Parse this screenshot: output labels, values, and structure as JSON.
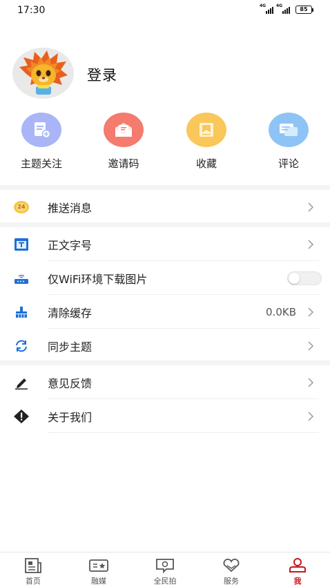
{
  "status_bar": {
    "time": "17:30",
    "network_1": "4G",
    "network_2": "4G",
    "battery": "85"
  },
  "profile": {
    "login_label": "登录",
    "avatar_icon": "lion-mascot-avatar"
  },
  "quick_actions": [
    {
      "label": "主题关注",
      "icon": "topic-follow-icon",
      "color": "#a9b5f7"
    },
    {
      "label": "邀请码",
      "icon": "invite-code-icon",
      "color": "#f47b6e"
    },
    {
      "label": "收藏",
      "icon": "favorites-icon",
      "color": "#f9c75a"
    },
    {
      "label": "评论",
      "icon": "comment-icon",
      "color": "#8ec4f5"
    }
  ],
  "menu": {
    "push": {
      "label": "推送消息",
      "badge": "24"
    },
    "font_size": {
      "label": "正文字号"
    },
    "wifi_only": {
      "label": "仅WiFi环境下载图片",
      "enabled": false
    },
    "clear_cache": {
      "label": "清除缓存",
      "value": "0.0KB"
    },
    "sync_theme": {
      "label": "同步主题"
    },
    "feedback": {
      "label": "意见反馈"
    },
    "about": {
      "label": "关于我们"
    }
  },
  "tabbar": {
    "active": "我",
    "accent": "#c8161d",
    "items": [
      {
        "label": "首页",
        "icon": "news-home-icon"
      },
      {
        "label": "融媒",
        "icon": "media-star-icon"
      },
      {
        "label": "全民拍",
        "icon": "camera-chat-icon"
      },
      {
        "label": "服务",
        "icon": "heart-hands-icon"
      },
      {
        "label": "我",
        "icon": "user-profile-icon"
      }
    ]
  }
}
